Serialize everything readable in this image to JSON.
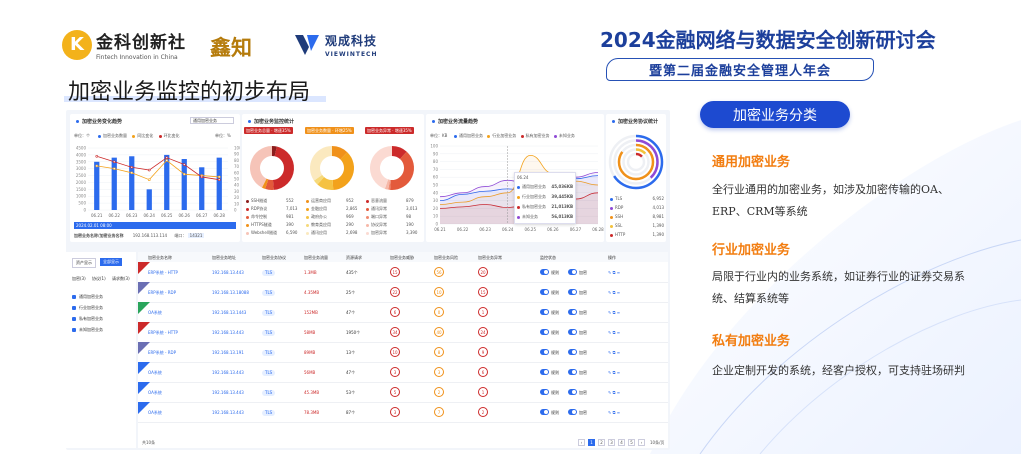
{
  "header": {
    "logo1_cn": "金科创新社",
    "logo1_en": "Fintech Innovation in China",
    "logo1_mark": "K",
    "logo2": "鑫知",
    "logo3_cn": "观成科技",
    "logo3_en": "VIEWINTECH",
    "conference": "2024金融网络与数据安全创新研讨会",
    "subconference": "暨第二届金融安全管理人年会"
  },
  "page_title": "加密业务监控的初步布局",
  "dashboard": {
    "trend": {
      "title": "加密业务变化趋势",
      "select": "通用加密业务",
      "unit_left": "单位：个",
      "unit_right": "单位：%",
      "legend": [
        "加密业务数量",
        "同比变化",
        "环比变化"
      ],
      "tooltip_date": "2024.02.01 08:00",
      "filter_label": "加密业务名称/加密业务名称",
      "ip": "192.168.113.114",
      "port_label": "端口：",
      "port": "14321"
    },
    "monitor": {
      "title": "加密业务监控统计",
      "badges": [
        "加密业务总量 · 增速35%",
        "加密业务数量 · 环增25%",
        "加密业务异常 · 增速35%"
      ],
      "col1": [
        [
          "SSH隧道",
          "552"
        ],
        [
          "RDP协议",
          "7,013"
        ],
        [
          "命令控制",
          "981"
        ],
        [
          "HTTPS隧道",
          "390"
        ],
        [
          "Webshell隧道",
          "6,590"
        ]
      ],
      "col2": [
        [
          "运营商应用",
          "952"
        ],
        [
          "金融应用",
          "2,865"
        ],
        [
          "政府办公",
          "969"
        ],
        [
          "教育类应用",
          "290"
        ],
        [
          "通讯应用",
          "2,698"
        ]
      ],
      "col3": [
        [
          "恶意流量",
          "879"
        ],
        [
          "通讯异常",
          "3,013"
        ],
        [
          "端口异常",
          "98"
        ],
        [
          "协议异常",
          "190"
        ],
        [
          "加密异常",
          "3,390"
        ]
      ]
    },
    "flow": {
      "title": "加密业务流量趋势",
      "unit": "单位：KB",
      "legend": [
        "通用加密业务",
        "行业加密业务",
        "私有加密业务",
        "未知业务"
      ],
      "tip_date": "06.24",
      "tip_rows": [
        [
          "通用加密业务",
          "45,036KB"
        ],
        [
          "行业加密业务",
          "39,445KB"
        ],
        [
          "私有加密业务",
          "21,013KB"
        ],
        [
          "未知业务",
          "56,013KB"
        ]
      ]
    },
    "protocol": {
      "title": "加密业务协议统计",
      "items": [
        [
          "TLS",
          "6,952"
        ],
        [
          "RDP",
          "4,013"
        ],
        [
          "SSH",
          "8,981"
        ],
        [
          "SSL",
          "1,390"
        ],
        [
          "HTTP",
          "1,390"
        ]
      ]
    },
    "sidebar": {
      "tabs": [
        "资产显示",
        "全部显示"
      ],
      "sub": [
        "加密(3)",
        "协议(1)",
        "请求数(3)"
      ],
      "items": [
        "通用加密业务",
        "行业加密业务",
        "私有加密业务",
        "未知加密业务"
      ]
    },
    "table": {
      "headers": [
        "加密业务名称",
        "加密业务地址",
        "加密业务协议",
        "加密业务流量",
        "资源请求",
        "加密业务威胁",
        "加密业务风险",
        "加密业务异常",
        "监控状态",
        "操作"
      ],
      "rows": [
        [
          "ERP系统 - HTTP",
          "192.168.13.443",
          "TLS",
          "1.3MB",
          "435个",
          "15",
          "56",
          "20"
        ],
        [
          "ERP系统 - RDP",
          "192.168.13.18088",
          "TLS",
          "4.35MB",
          "25个",
          "22",
          "10",
          "15"
        ],
        [
          "OA系统",
          "192.168.13.1443",
          "TLS",
          "152MB",
          "47个",
          "6",
          "0",
          "1"
        ],
        [
          "ERP系统 - HTTP",
          "192.168.13.443",
          "TLS",
          "58MB",
          "1950个",
          "34",
          "40",
          "24"
        ],
        [
          "ERP系统 - RDP",
          "192.168.13.191",
          "TLS",
          "89MB",
          "13个",
          "10",
          "8",
          "9"
        ],
        [
          "OA系统",
          "192.168.13.443",
          "TLS",
          "56MB",
          "47个",
          "3",
          "3",
          "6"
        ],
        [
          "OA系统",
          "192.168.13.443",
          "TLS",
          "45.3MB",
          "53个",
          "5",
          "2",
          "1"
        ],
        [
          "OA系统",
          "192.168.13.443",
          "TLS",
          "78.3MB",
          "87个",
          "3",
          "7",
          "2"
        ]
      ],
      "toggle_labels": [
        "规则",
        "加密"
      ],
      "total": "共10条",
      "page_size": "10条/页",
      "goto": "前往",
      "goto_page": "20"
    }
  },
  "right_panel": {
    "heading": "加密业务分类",
    "sections": [
      {
        "title": "通用加密业务",
        "text": "全行业通用的加密业务，如涉及加密传输的OA、ERP、CRM等系统"
      },
      {
        "title": "行业加密业务",
        "text": "局限于行业内的业务系统，如证券行业的证券交易系统、结算系统等"
      },
      {
        "title": "私有加密业务",
        "text": "企业定制开发的系统，经客户授权，可支持驻场研判"
      }
    ]
  },
  "chart_data": [
    {
      "type": "bar",
      "title": "加密业务变化趋势",
      "categories": [
        "06.21",
        "06.22",
        "06.23",
        "06.24",
        "06.25",
        "06.26",
        "06.27",
        "06.28"
      ],
      "series": [
        {
          "name": "加密业务数量",
          "values": [
            3500,
            3800,
            3900,
            1500,
            4000,
            3700,
            3100,
            3800
          ]
        },
        {
          "name": "同比变化",
          "values": [
            3200,
            3000,
            2700,
            2200,
            3600,
            2600,
            2500,
            2400
          ]
        },
        {
          "name": "环比变化",
          "values": [
            3900,
            3500,
            3100,
            2900,
            3800,
            3300,
            2400,
            2200
          ]
        }
      ],
      "ylim": [
        0,
        4500
      ],
      "y2lim": [
        0,
        100
      ]
    },
    {
      "type": "line",
      "title": "加密业务流量趋势",
      "categories": [
        "06.21",
        "06.22",
        "06.23",
        "06.24",
        "06.25",
        "06.26",
        "06.27",
        "06.28"
      ],
      "series": [
        {
          "name": "通用加密业务",
          "values": [
            30,
            38,
            42,
            45,
            41,
            55,
            58,
            62
          ]
        },
        {
          "name": "行业加密业务",
          "values": [
            25,
            28,
            35,
            40,
            88,
            65,
            55,
            50
          ]
        },
        {
          "name": "私有加密业务",
          "values": [
            20,
            22,
            25,
            21,
            26,
            30,
            32,
            40
          ]
        },
        {
          "name": "未知业务",
          "values": [
            35,
            40,
            48,
            56,
            50,
            53,
            60,
            66
          ]
        }
      ],
      "ylim": [
        0,
        100
      ]
    },
    {
      "type": "pie",
      "title": "加密业务协议统计",
      "categories": [
        "TLS",
        "RDP",
        "SSH",
        "SSL",
        "HTTP"
      ],
      "values": [
        6952,
        4013,
        8981,
        1390,
        1390
      ]
    }
  ]
}
